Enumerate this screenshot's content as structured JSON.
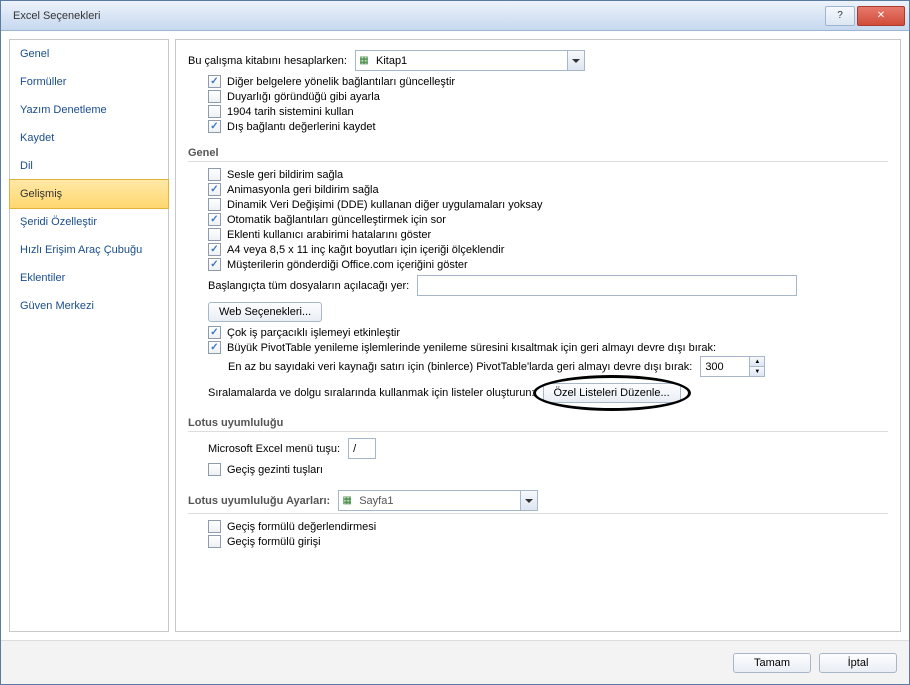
{
  "titlebar": {
    "title": "Excel Seçenekleri"
  },
  "sidebar": {
    "items": [
      {
        "label": "Genel"
      },
      {
        "label": "Formüller"
      },
      {
        "label": "Yazım Denetleme"
      },
      {
        "label": "Kaydet"
      },
      {
        "label": "Dil"
      },
      {
        "label": "Gelişmiş"
      },
      {
        "label": "Şeridi Özelleştir"
      },
      {
        "label": "Hızlı Erişim Araç Çubuğu"
      },
      {
        "label": "Eklentiler"
      },
      {
        "label": "Güven Merkezi"
      }
    ],
    "selected_index": 5
  },
  "content": {
    "calc_row_label": "Bu çalışma kitabını hesaplarken:",
    "calc_dropdown": "Kitap1",
    "chk_update_links": "Diğer belgelere yönelik bağlantıları güncelleştir",
    "chk_precision": "Duyarlığı göründüğü gibi ayarla",
    "chk_1904": "1904 tarih sistemini kullan",
    "chk_save_ext": "Dış bağlantı değerlerini kaydet",
    "section_genel": "Genel",
    "chk_sound": "Sesle geri bildirim sağla",
    "chk_anim": "Animasyonla geri bildirim sağla",
    "chk_dde": "Dinamik Veri Değişimi (DDE) kullanan diğer uygulamaları yoksay",
    "chk_auto_links": "Otomatik bağlantıları güncelleştirmek için sor",
    "chk_addin_err": "Eklenti kullanıcı arabirimi hatalarını göster",
    "chk_a4": "A4 veya 8,5 x 11 inç kağıt boyutları için içeriği ölçeklendir",
    "chk_office": "Müşterilerin gönderdiği Office.com içeriğini göster",
    "startup_label": "Başlangıçta tüm dosyaların açılacağı yer:",
    "startup_value": "",
    "web_opts": "Web Seçenekleri...",
    "chk_multi": "Çok iş parçacıklı işlemeyi etkinleştir",
    "chk_pivot": "Büyük PivotTable yenileme işlemlerinde yenileme süresini kısaltmak için geri almayı devre dışı bırak:",
    "pivot_sub": "En az bu sayıdaki veri kaynağı satırı için (binlerce) PivotTable'larda geri almayı devre dışı bırak:",
    "pivot_value": "300",
    "lists_label": "Sıralamalarda ve dolgu sıralarında kullanmak için listeler oluşturun:",
    "lists_btn": "Özel Listeleri Düzenle...",
    "section_lotus": "Lotus uyumluluğu",
    "menu_key_label": "Microsoft Excel menü tuşu:",
    "menu_key_value": "/",
    "chk_transition_nav": "Geçiş gezinti tuşları",
    "lotus_settings_label": "Lotus uyumluluğu Ayarları:",
    "lotus_dropdown": "Sayfa1",
    "chk_transition_eval": "Geçiş formülü değerlendirmesi",
    "chk_transition_entry": "Geçiş formülü girişi"
  },
  "footer": {
    "ok": "Tamam",
    "cancel": "İptal"
  }
}
